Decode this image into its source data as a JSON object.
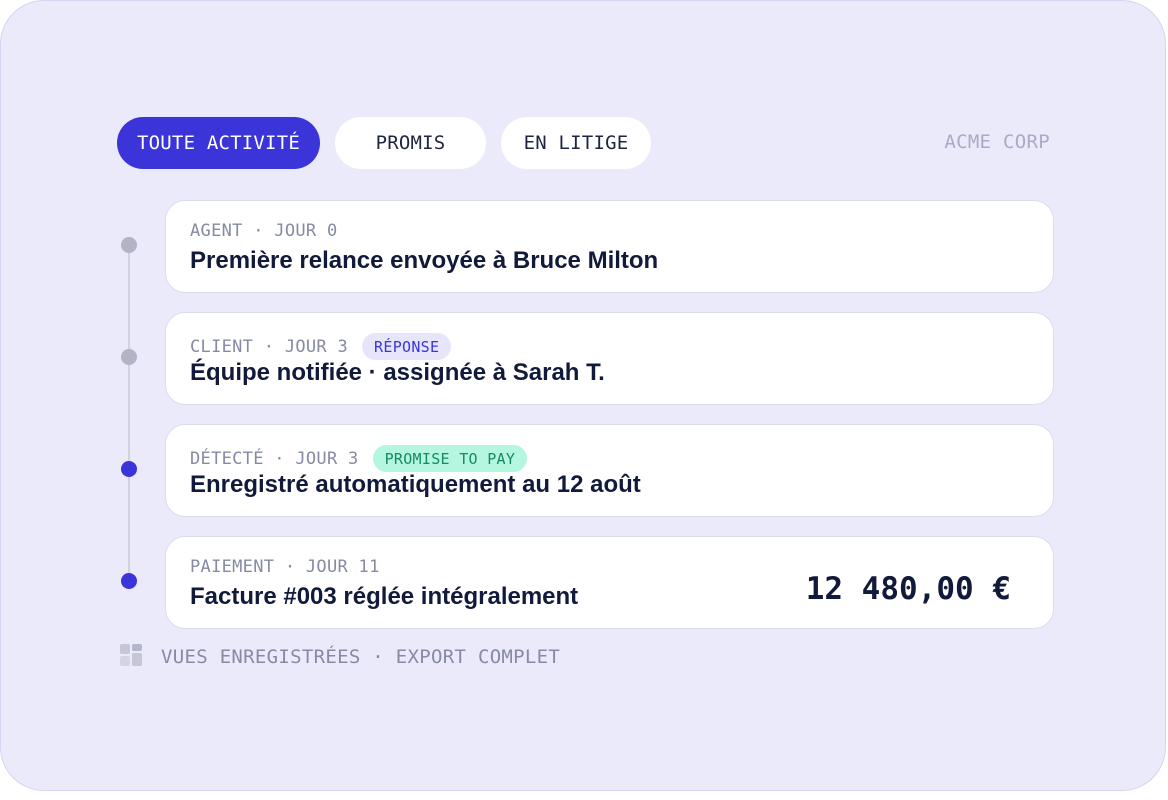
{
  "tabs": [
    {
      "label": "TOUTE ACTIVITÉ",
      "active": true
    },
    {
      "label": "PROMIS",
      "active": false
    },
    {
      "label": "EN LITIGE",
      "active": false
    }
  ],
  "company": "ACME CORP",
  "events": [
    {
      "meta": "AGENT · JOUR 0",
      "badge": null,
      "title": "Première relance envoyée à Bruce Milton",
      "dot": "gray"
    },
    {
      "meta": "CLIENT · JOUR 3",
      "badge": "RÉPONSE",
      "title": "Équipe notifiée · assignée à Sarah T.",
      "dot": "gray"
    },
    {
      "meta": "DÉTECTÉ · JOUR 3",
      "badge": "PROMISE TO PAY",
      "title": "Enregistré automatiquement au 12 août",
      "dot": "blue"
    },
    {
      "meta": "PAIEMENT · JOUR 11",
      "badge": null,
      "title": "Facture #003 réglée intégralement",
      "amount": "12 480,00 €",
      "dot": "blue"
    }
  ],
  "footer": {
    "icon": "grid-icon",
    "text": "VUES ENREGISTRÉES · EXPORT COMPLET"
  },
  "colors": {
    "accent": "#3b34d9",
    "background": "#ebeafa",
    "promise_badge": "#b4f6df",
    "reponse_badge": "#e6e5fb"
  }
}
